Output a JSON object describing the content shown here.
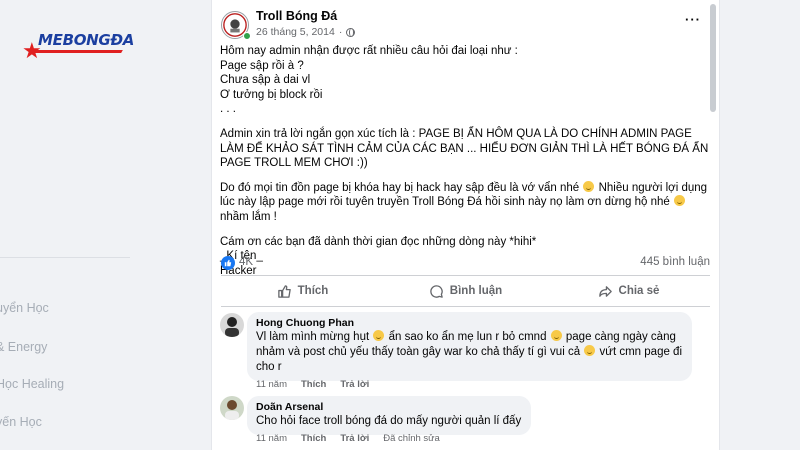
{
  "background": {
    "logo_text": "MEBONGĐA",
    "sidebar_items": [
      "uyển Học",
      "& Energy",
      "Học Healing",
      "yến Học"
    ]
  },
  "post": {
    "page_name": "Troll Bóng Đá",
    "date": "26 tháng 5, 2014",
    "date_separator": "·",
    "more_label": "···",
    "paragraph1": "Hôm nay admin nhận được rất nhiều câu hỏi đai loại như :\nPage sập rồi à ?\nChưa sập à dai vl\nƠ tưởng bị block rồi\n. . .",
    "paragraph2": "Admin xin trả lời ngắn gọn xúc tích là : PAGE BỊ ẨN HÔM QUA LÀ DO CHÍNH ADMIN PAGE LÀM ĐỂ KHẢO SÁT TÌNH CẢM CỦA CÁC BẠN ... HIỂU ĐƠN GIẢN THÌ LÀ HẾT BÓNG ĐÁ ẨN PAGE TROLL MEM CHƠI :))",
    "paragraph3_a": "Do đó mọi tin đồn page bị khóa hay bị hack hay sập đều là vớ vẩn nhé",
    "paragraph3_b": "Nhiều người lợi dụng lúc này lập page mới rồi tuyên truyền Troll Bóng Đá hồi sinh này nọ làm ơn dừng hộ nhé",
    "paragraph3_c": "nhầm lắm !",
    "paragraph4": "Cám ơn các bạn đã dành thời gian đọc những dòng này *hihi*\n_Kí tên_\nHacker",
    "like_count": "4K",
    "comment_count": "445 bình luận",
    "actions": {
      "like": "Thích",
      "comment": "Bình luận",
      "share": "Chia sẻ"
    }
  },
  "comments": [
    {
      "name": "Hong Chuong Phan",
      "text_a": "Vl làm mình mừng hụt",
      "text_b": "ẩn sao ko ẩn mẹ lun r bỏ cmnd",
      "text_c": "page càng ngày càng nhảm và post chủ yếu thấy toàn gây war ko chả thấy tí gì vui cả",
      "text_d": "vứt cmn page đi cho r",
      "time": "11 năm",
      "like": "Thích",
      "reply": "Trả lời",
      "edited": ""
    },
    {
      "name": "Doãn Arsenal",
      "text": "Cho hỏi face troll bóng đá do mấy người quản lí đấy",
      "time": "11 năm",
      "like": "Thích",
      "reply": "Trả lời",
      "edited": "Đã chỉnh sửa"
    }
  ],
  "colors": {
    "accent": "#1877f2",
    "online": "#31a24c",
    "muted_text": "#65676b",
    "comment_bubble": "#f0f2f5"
  }
}
